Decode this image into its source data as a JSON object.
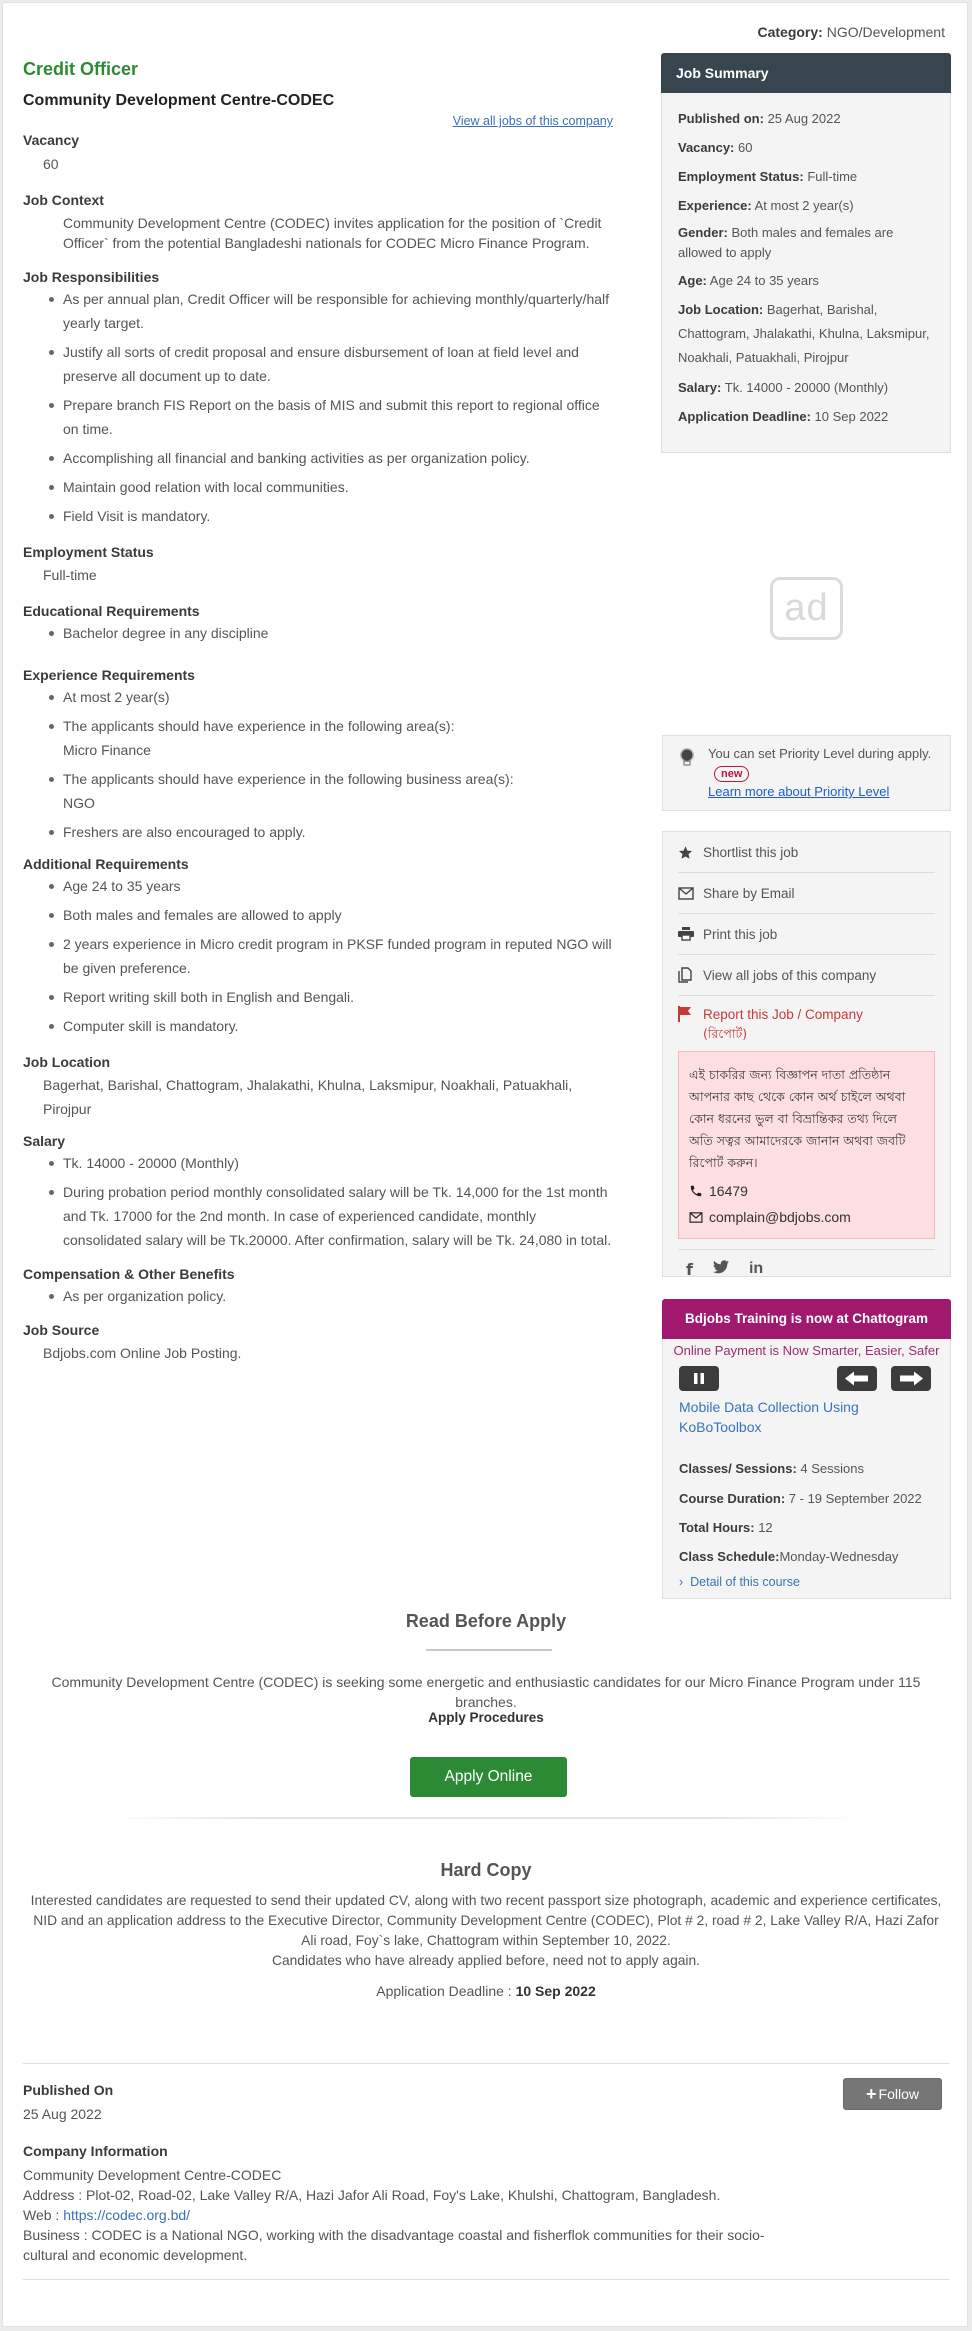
{
  "category": {
    "label": "Category:",
    "value": "NGO/Development"
  },
  "job": {
    "title": "Credit Officer",
    "company": "Community Development Centre-CODEC",
    "view_all_link": "View all jobs of this company"
  },
  "sections": {
    "vacancy": {
      "heading": "Vacancy",
      "value": "60"
    },
    "job_context": {
      "heading": "Job Context",
      "text": "Community Development Centre (CODEC) invites application for the position of `Credit Officer` from the potential Bangladeshi nationals for CODEC Micro Finance Program."
    },
    "responsibilities": {
      "heading": "Job Responsibilities",
      "items": [
        "As per annual plan, Credit Officer will be responsible for achieving monthly/quarterly/half yearly target.",
        "Justify all sorts of credit proposal and ensure disbursement of loan at field level and preserve all document up to date.",
        "Prepare branch FIS Report on the basis of MIS and submit this report to regional office on time.",
        "Accomplishing all financial and banking activities as per organization policy.",
        "Maintain good relation with local communities.",
        "Field Visit is mandatory."
      ]
    },
    "employment_status": {
      "heading": "Employment Status",
      "value": "Full-time"
    },
    "education": {
      "heading": "Educational Requirements",
      "items": [
        "Bachelor degree in any discipline"
      ]
    },
    "experience": {
      "heading": "Experience Requirements",
      "items": [
        {
          "text": "At most 2 year(s)",
          "sub": ""
        },
        {
          "text": "The applicants should have experience in the following area(s):",
          "sub": "Micro Finance"
        },
        {
          "text": "The applicants should have experience in the following business area(s):",
          "sub": "NGO"
        },
        {
          "text": "Freshers are also encouraged to apply.",
          "sub": ""
        }
      ]
    },
    "additional": {
      "heading": "Additional Requirements",
      "items": [
        "Age 24 to 35 years",
        "Both males and females are allowed to apply",
        "2 years experience in Micro credit program in PKSF funded program in reputed NGO will be given preference.",
        "Report writing skill both in English and Bengali.",
        "Computer skill is mandatory."
      ]
    },
    "job_location": {
      "heading": "Job Location",
      "value": "Bagerhat, Barishal, Chattogram, Jhalakathi, Khulna, Laksmipur, Noakhali, Patuakhali, Pirojpur"
    },
    "salary": {
      "heading": "Salary",
      "items": [
        "Tk. 14000 - 20000 (Monthly)",
        "During probation period monthly consolidated salary will be Tk. 14,000 for the 1st month and Tk. 17000 for the 2nd month. In case of experienced candidate, monthly consolidated salary will be Tk.20000. After confirmation, salary will be Tk. 24,080 in total."
      ]
    },
    "compensation": {
      "heading": "Compensation & Other Benefits",
      "items": [
        "As per organization policy."
      ]
    },
    "job_source": {
      "heading": "Job Source",
      "value": "Bdjobs.com Online Job Posting."
    }
  },
  "summary": {
    "title": "Job Summary",
    "rows": [
      {
        "label": "Published on:",
        "value": "25 Aug 2022"
      },
      {
        "label": "Vacancy:",
        "value": " 60"
      },
      {
        "label": "Employment Status:",
        "value": "Full-time"
      },
      {
        "label": "Experience:",
        "value": "At most 2 year(s)"
      },
      {
        "label": "Gender:",
        "value": "Both males and females are allowed to apply"
      },
      {
        "label": "Age:",
        "value": "Age 24 to 35 years"
      },
      {
        "label": "Job Location:",
        "value": "Bagerhat, Barishal, Chattogram, Jhalakathi, Khulna, Laksmipur, Noakhali, Patuakhali, Pirojpur"
      },
      {
        "label": "Salary:",
        "value": "Tk. 14000 - 20000 (Monthly)"
      },
      {
        "label": "Application Deadline:",
        "value": "10 Sep 2022"
      }
    ]
  },
  "ad": {
    "label": "ad"
  },
  "priority": {
    "text": "You can set Priority Level during apply.",
    "badge": "new",
    "link": "Learn more about Priority Level"
  },
  "actions": {
    "shortlist": "Shortlist this job",
    "share_email": "Share by Email",
    "print": "Print this job",
    "view_all": "View all jobs of this company",
    "report": "Report this Job / Company",
    "report_bn": "(রিপোর্ট)",
    "warning_bn": "এই চাকরির জন্য বিজ্ঞাপন দাতা প্রতিষ্ঠান আপনার কাছ থেকে কোন অর্থ চাইলে অথবা কোন ধরনের ভুল বা বিভ্রান্তিকর তথ্য দিলে অতি সত্বর আমাদেরকে জানান অথবা জবটি রিপোর্ট করুন।",
    "phone": "16479",
    "email": "complain@bdjobs.com",
    "social": [
      "f",
      "t",
      "in"
    ]
  },
  "training": {
    "title": "Bdjobs Training is now at Chattogram",
    "marquee": "Online Payment is Now Smarter, Easier, Safer",
    "course": "Mobile Data Collection Using KoBoToolbox",
    "rows": [
      {
        "label": "Classes/ Sessions:",
        "value": " 4 Sessions"
      },
      {
        "label": "Course Duration:",
        "value": " 7 - 19 September 2022"
      },
      {
        "label": "Total Hours:",
        "value": " 12"
      },
      {
        "label": "Class Schedule:",
        "value": "Monday-Wednesday"
      }
    ],
    "detail_link": "Detail of this course"
  },
  "read_before_apply": {
    "title": "Read Before Apply",
    "text": "Community Development Centre (CODEC) is seeking some energetic and enthusiastic candidates for our Micro Finance Program under 115 branches.",
    "procedures": "Apply Procedures",
    "apply_button": "Apply Online"
  },
  "hard_copy": {
    "title": "Hard Copy",
    "text": "Interested candidates are requested to send their updated CV, along with two recent passport size photograph, academic and experience certificates, NID and an application address to the Executive Director, Community Development Centre (CODEC), Plot # 2, road # 2, Lake Valley R/A, Hazi Zafor Ali road, Foy`s lake, Chattogram within September 10, 2022.",
    "note": "Candidates who have already applied before, need not to apply again.",
    "deadline_label": "Application Deadline : ",
    "deadline_value": "10 Sep 2022"
  },
  "footer": {
    "follow_button": "Follow",
    "published_heading": "Published On",
    "published_value": "25 Aug 2022",
    "company_heading": "Company Information",
    "company_name": "Community Development Centre-CODEC",
    "address": "Address : Plot-02, Road-02, Lake Valley R/A, Hazi Jafor Ali Road, Foy's Lake, Khulshi, Chattogram, Bangladesh.",
    "web_label": "Web : ",
    "web_url": "https://codec.org.bd/",
    "business": "Business : CODEC is a National NGO, working with the disadvantage coastal and fisherflok communities for their socio-cultural and economic development."
  },
  "colors": {
    "title_green": "#2d8a34",
    "summary_header": "#37464e",
    "training_header": "#a0196e",
    "report_red": "#c73a3a",
    "link_blue": "#3b6fb6"
  }
}
